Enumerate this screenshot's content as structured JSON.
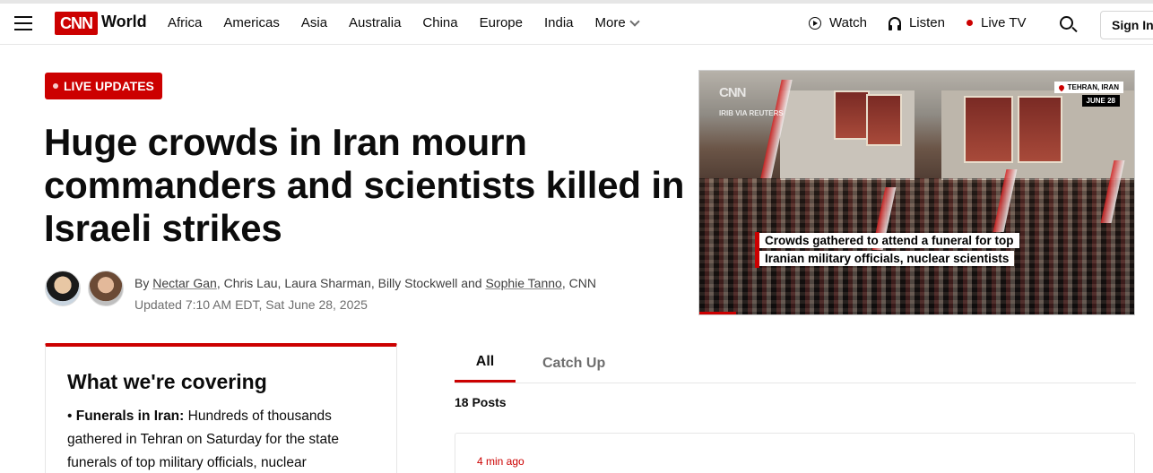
{
  "header": {
    "logo_text": "CNN",
    "section": "World",
    "nav_items": [
      "Africa",
      "Americas",
      "Asia",
      "Australia",
      "China",
      "Europe",
      "India"
    ],
    "more_label": "More",
    "watch_label": "Watch",
    "listen_label": "Listen",
    "live_tv_label": "Live TV",
    "sign_in_label": "Sign In",
    "accent_color": "#cc0000"
  },
  "article": {
    "badge": "LIVE UPDATES",
    "headline": "Huge crowds in Iran mourn commanders and scientists killed in Israeli strikes",
    "byline_prefix": "By ",
    "authors": [
      "Nectar Gan",
      "Chris Lau",
      "Laura Sharman",
      "Billy Stockwell",
      "Sophie Tanno"
    ],
    "byline_suffix": ", CNN",
    "updated": "Updated 7:10 AM EDT, Sat June 28, 2025"
  },
  "hero": {
    "bug": "CNN",
    "credit": "IRIB VIA REUTERS",
    "location": "TEHRAN, IRAN",
    "date": "JUNE 28",
    "caption_line1": "Crowds gathered to attend a funeral for top",
    "caption_line2": "Iranian military officials, nuclear scientists"
  },
  "covering": {
    "title": "What we're covering",
    "bullet_label": "Funerals in Iran:",
    "bullet_text": " Hundreds of thousands gathered in Tehran on Saturday for the state funerals of top military officials, nuclear"
  },
  "feed": {
    "tabs": [
      "All",
      "Catch Up"
    ],
    "posts_count": "18 Posts",
    "first_post_time": "4 min ago"
  }
}
